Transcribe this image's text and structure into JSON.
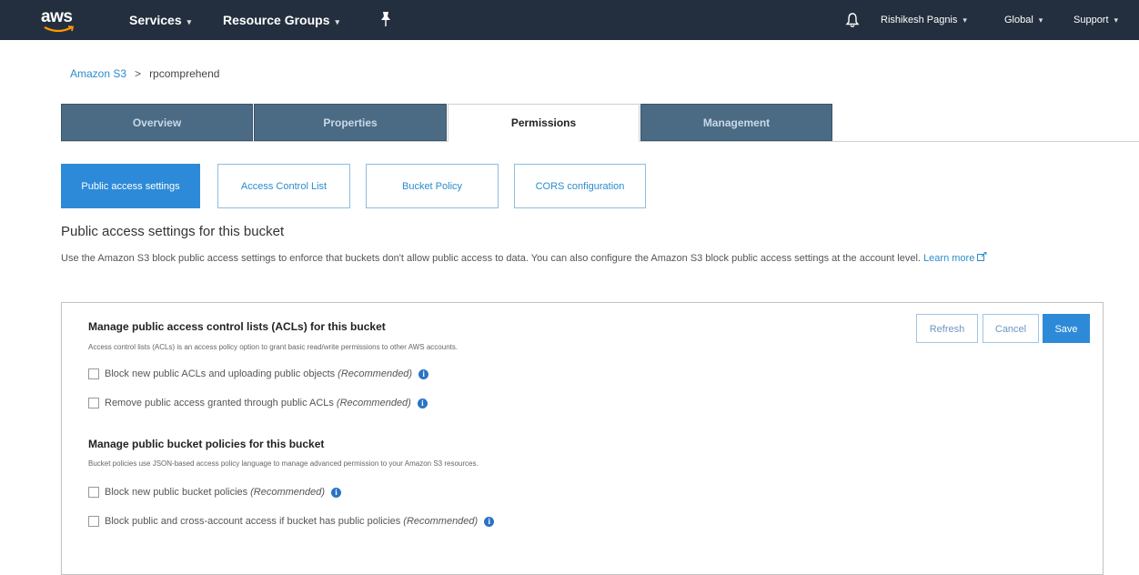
{
  "topnav": {
    "logo": "aws",
    "services": "Services",
    "resource_groups": "Resource Groups",
    "user": "Rishikesh Pagnis",
    "region": "Global",
    "support": "Support",
    "caret": "▾"
  },
  "breadcrumb": {
    "root": "Amazon S3",
    "separator": ">",
    "current": "rpcomprehend"
  },
  "tabs": [
    {
      "label": "Overview"
    },
    {
      "label": "Properties"
    },
    {
      "label": "Permissions"
    },
    {
      "label": "Management"
    }
  ],
  "subtabs": [
    {
      "label": "Public access settings"
    },
    {
      "label": "Access Control List"
    },
    {
      "label": "Bucket Policy"
    },
    {
      "label": "CORS configuration"
    }
  ],
  "section": {
    "title": "Public access settings for this bucket",
    "description": "Use the Amazon S3 block public access settings to enforce that buckets don't allow public access to data. You can also configure the Amazon S3 block public access settings at the account level.",
    "learn_more": "Learn more"
  },
  "buttons": {
    "refresh": "Refresh",
    "cancel": "Cancel",
    "save": "Save"
  },
  "acls": {
    "heading": "Manage public access control lists (ACLs) for this bucket",
    "subtext": "Access control lists (ACLs) is an access policy option to grant basic read/write permissions to other AWS accounts.",
    "options": [
      {
        "label": "Block new public ACLs and uploading public objects",
        "rec": "(Recommended)"
      },
      {
        "label": "Remove public access granted through public ACLs",
        "rec": "(Recommended)"
      }
    ]
  },
  "policies": {
    "heading": "Manage public bucket policies for this bucket",
    "subtext": "Bucket policies use JSON-based access policy language to manage advanced permission to your Amazon S3 resources.",
    "options": [
      {
        "label": "Block new public bucket policies",
        "rec": "(Recommended)"
      },
      {
        "label": "Block public and cross-account access if bucket has public policies",
        "rec": "(Recommended)"
      }
    ]
  },
  "colors": {
    "nav_bg": "#232f3e",
    "tab_bg": "#4b6a83",
    "accent": "#2d8ad8",
    "info": "#2a73c6"
  }
}
